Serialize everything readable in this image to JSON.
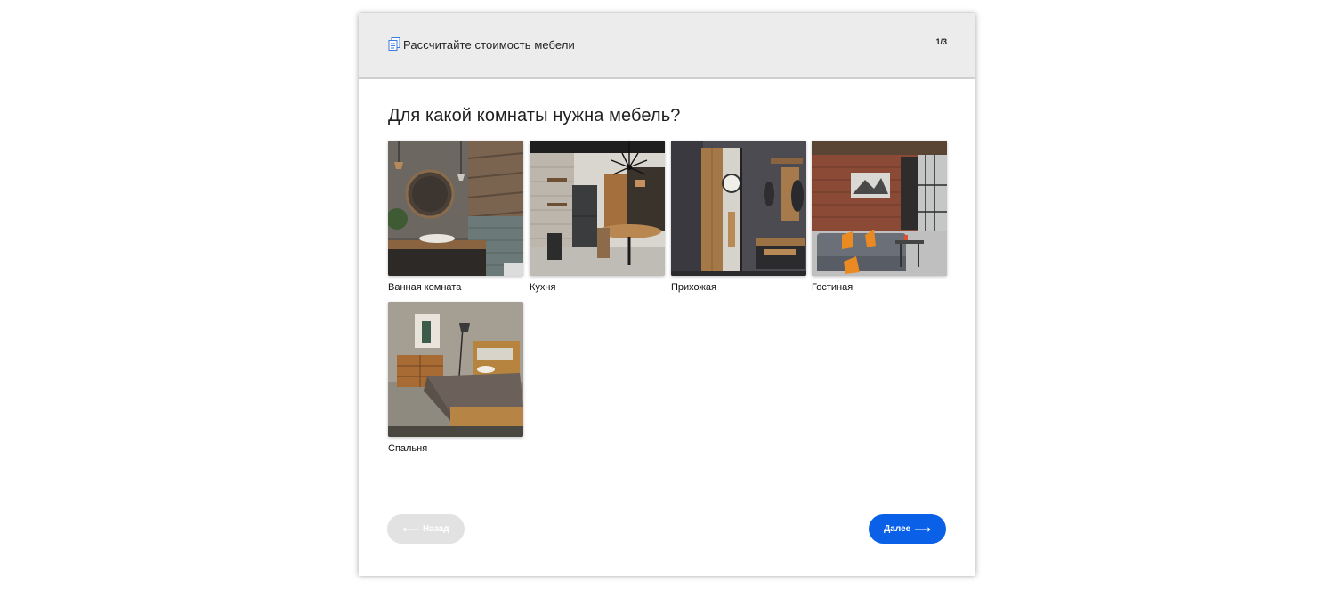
{
  "header": {
    "icon": "document-icon",
    "title": "Рассчитайте стоимость мебели",
    "step": "1/3"
  },
  "question": "Для какой комнаты нужна мебель?",
  "options": [
    {
      "label": "Ванная комната",
      "image": "bathroom-photo"
    },
    {
      "label": "Кухня",
      "image": "kitchen-photo"
    },
    {
      "label": "Прихожая",
      "image": "hallway-photo"
    },
    {
      "label": "Гостиная",
      "image": "living-room-photo"
    },
    {
      "label": "Спальня",
      "image": "bedroom-photo"
    }
  ],
  "buttons": {
    "back_label": "Назад",
    "back_icon": "arrow-left-icon",
    "next_label": "Далее",
    "next_icon": "arrow-right-icon"
  },
  "colors": {
    "header_bg": "#ececec",
    "accent": "#0a61e8",
    "disabled": "#e2e2e2"
  }
}
